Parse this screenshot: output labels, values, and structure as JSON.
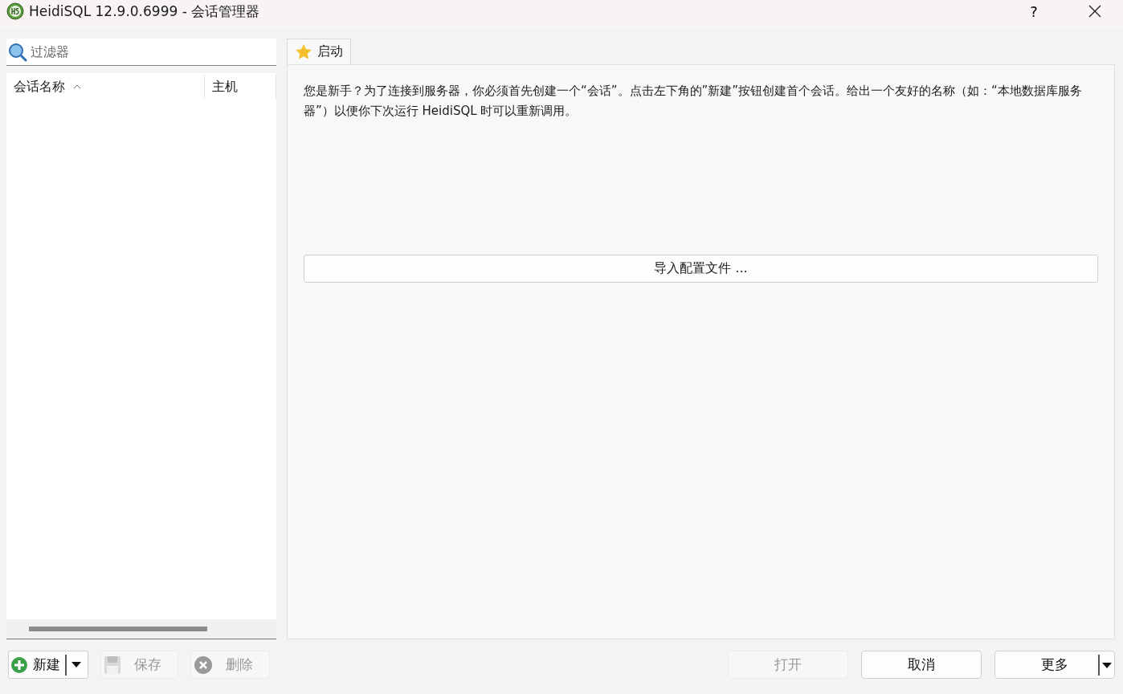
{
  "window": {
    "title": "HeidiSQL 12.9.0.6999 - 会话管理器",
    "help": "?"
  },
  "filter": {
    "placeholder": "过滤器"
  },
  "session_list": {
    "columns": [
      {
        "label": "会话名称",
        "sorted": true
      },
      {
        "label": "主机",
        "sorted": false
      }
    ]
  },
  "tabs": [
    {
      "label": "启动",
      "selected": true
    }
  ],
  "intro_text": "您是新手？为了连接到服务器，你必须首先创建一个“会话”。点击左下角的”新建”按钮创建首个会话。给出一个友好的名称（如：“本地数据库服务器”）以便你下次运行 HeidiSQL 时可以重新调用。",
  "import_button": "导入配置文件 ...",
  "left_buttons": [
    {
      "label": "新建",
      "kind": "new",
      "disabled": false,
      "dropdown": true
    },
    {
      "label": "保存",
      "kind": "save",
      "disabled": true,
      "dropdown": false
    },
    {
      "label": "删除",
      "kind": "delete",
      "disabled": true,
      "dropdown": false
    }
  ],
  "right_buttons": [
    {
      "label": "打开",
      "disabled": true,
      "dropdown": false
    },
    {
      "label": "取消",
      "disabled": false,
      "dropdown": false
    },
    {
      "label": "更多",
      "disabled": false,
      "dropdown": true
    }
  ]
}
